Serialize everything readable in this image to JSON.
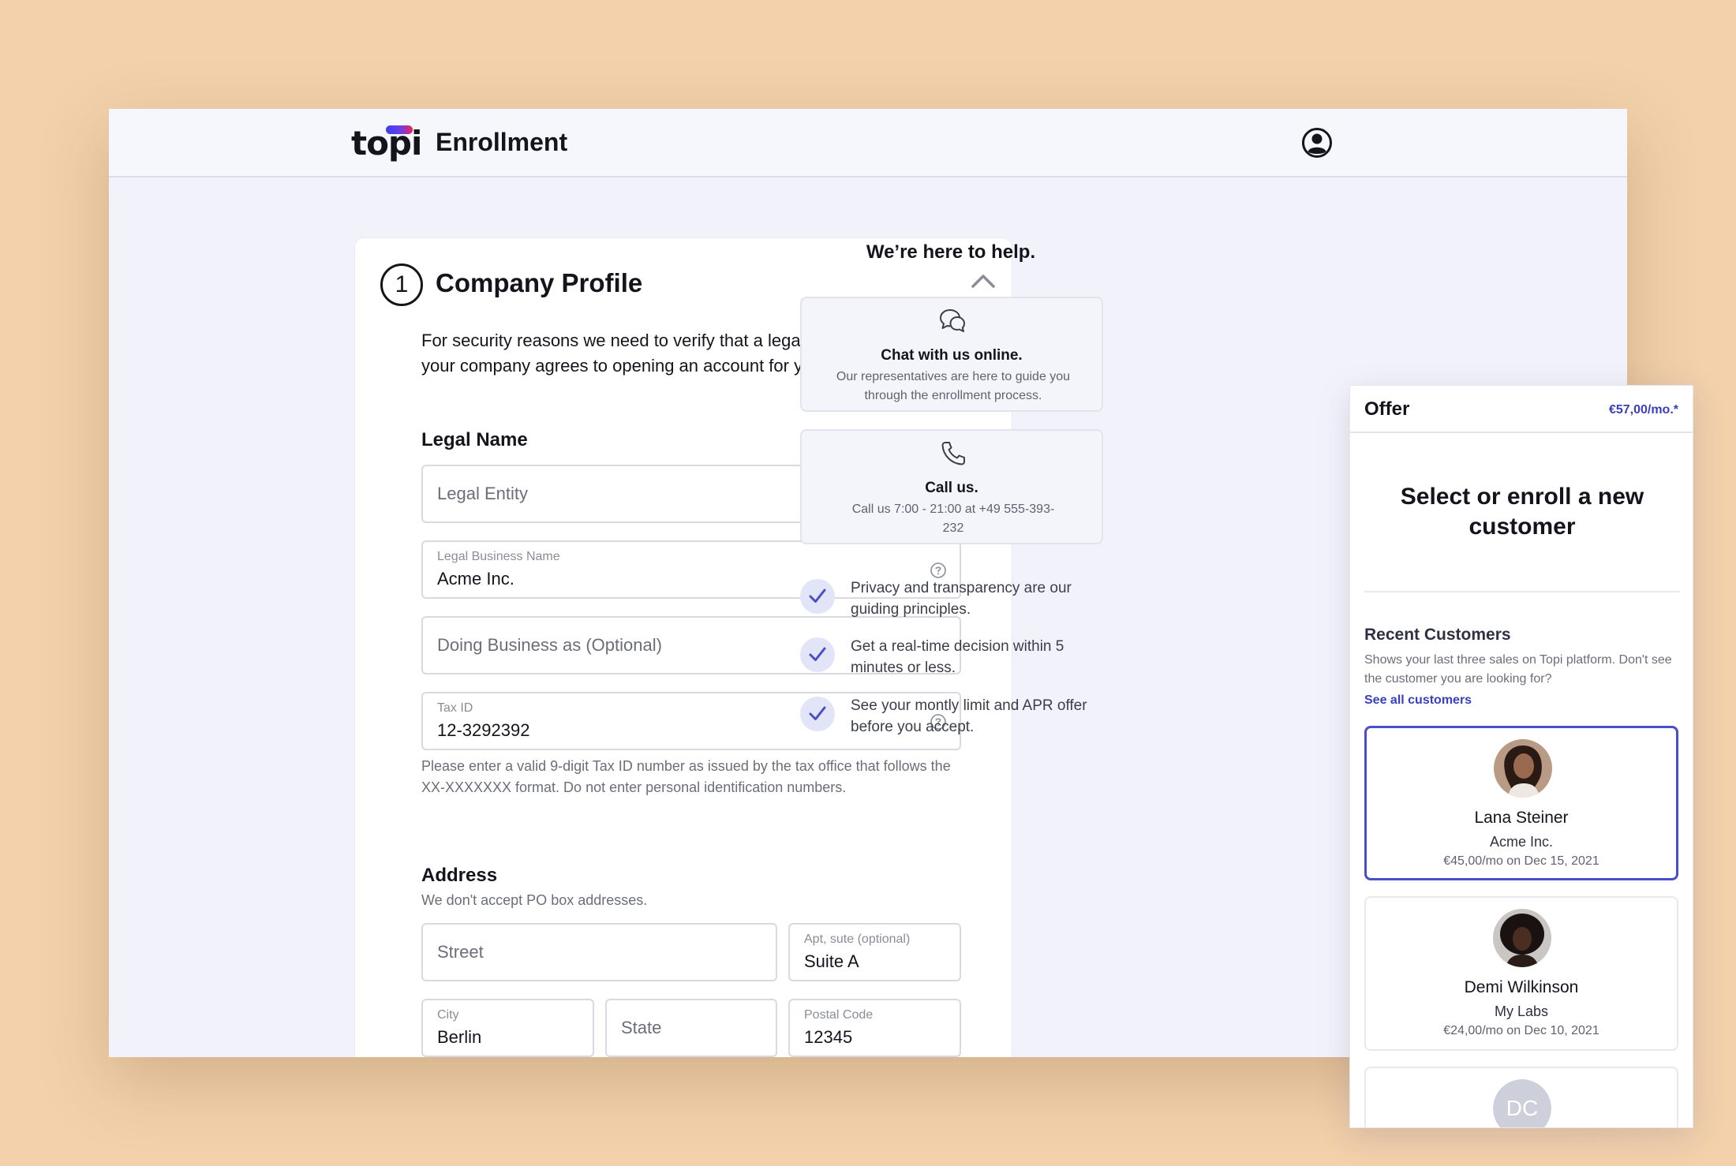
{
  "header": {
    "logo_text": "topi",
    "title": "Enrollment"
  },
  "form": {
    "step_number": "1",
    "title": "Company Profile",
    "intro": "For security reasons we need to verify that a legal representative of your company agrees to opening an account for your company.",
    "legal_name_label": "Legal Name",
    "legal_entity_placeholder": "Legal Entity",
    "legal_business_name_label": "Legal Business Name",
    "legal_business_name_value": "Acme Inc.",
    "dba_placeholder": "Doing Business as (Optional)",
    "tax_id_label": "Tax ID",
    "tax_id_value": "12-3292392",
    "tax_id_hint": "Please enter a valid 9-digit Tax ID number as issued by the tax office that follows the XX-XXXXXXX format. Do not enter personal identification numbers.",
    "address_label": "Address",
    "address_hint": "We don't accept PO box addresses.",
    "street_placeholder": "Street",
    "apt_label": "Apt, sute (optional)",
    "apt_value": "Suite A",
    "city_label": "City",
    "city_value": "Berlin",
    "state_placeholder": "State",
    "postal_label": "Postal Code",
    "postal_value": "12345"
  },
  "help": {
    "title": "We’re here to help.",
    "chat_title": "Chat with us online.",
    "chat_text": "Our representatives are here to guide you through the enrollment process.",
    "call_title": "Call us.",
    "call_text": "Call us 7:00 - 21:00 at +49 555-393-232",
    "checks": [
      "Privacy and transparency are our guiding principles.",
      "Get a real-time decision within 5 minutes or less.",
      "See your montly limit and APR offer before you accept."
    ]
  },
  "offer": {
    "title": "Offer",
    "price": "€57,00/mo.*",
    "heading": "Select or enroll a new customer",
    "recent_title": "Recent Customers",
    "recent_desc": "Shows your last three sales on Topi platform. Don't see the customer you are looking for?",
    "see_all": "See all customers",
    "customers": [
      {
        "name": "Lana Steiner",
        "company": "Acme Inc.",
        "meta": "€45,00/mo on Dec 15, 2021"
      },
      {
        "name": "Demi Wilkinson",
        "company": "My Labs",
        "meta": "€24,00/mo on Dec 10, 2021"
      },
      {
        "initials": "DC"
      }
    ]
  },
  "colors": {
    "background": "#f2d1ab",
    "accent": "#3b3fbf",
    "selected_border": "#4a4fc7"
  }
}
